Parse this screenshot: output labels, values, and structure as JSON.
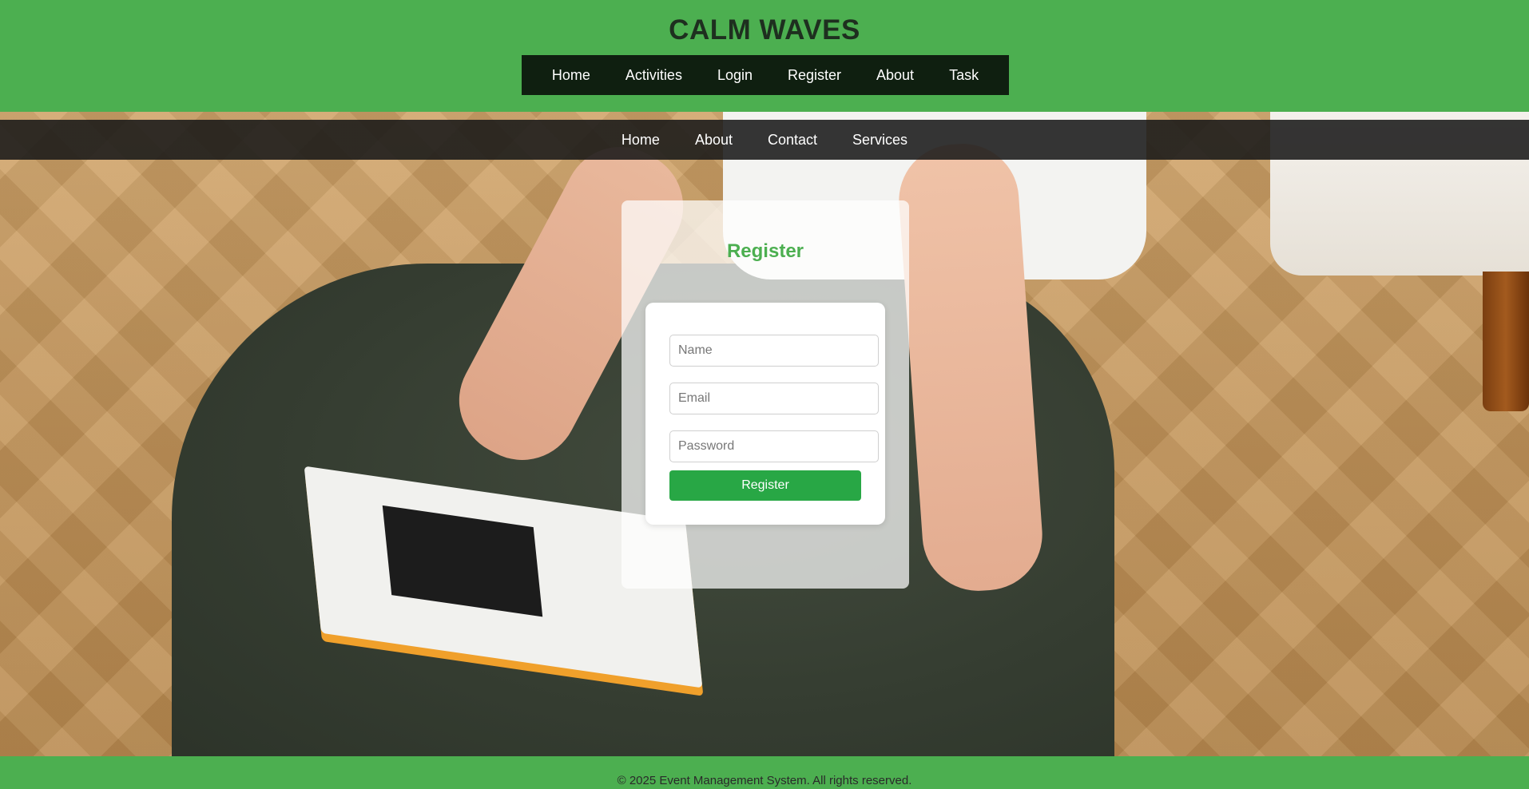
{
  "header": {
    "title": "CALM WAVES",
    "nav": [
      "Home",
      "Activities",
      "Login",
      "Register",
      "About",
      "Task"
    ]
  },
  "sub_nav": [
    "Home",
    "About",
    "Contact",
    "Services"
  ],
  "register": {
    "heading": "Register",
    "name_placeholder": "Name",
    "email_placeholder": "Email",
    "password_placeholder": "Password",
    "submit_label": "Register"
  },
  "footer": {
    "text": "© 2025 Event Management System. All rights reserved."
  },
  "colors": {
    "brand_green": "#4caf50",
    "button_green": "#28a745",
    "nav_dark": "#0f1f10"
  }
}
